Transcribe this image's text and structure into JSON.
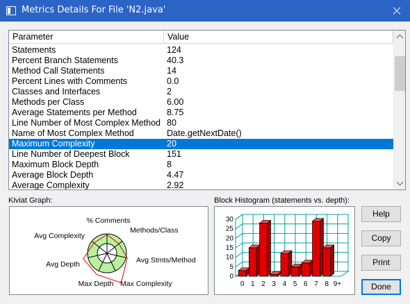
{
  "window": {
    "title": "Metrics Details For File 'N2.java'",
    "icon": "app-window-icon",
    "close_icon": "close-icon"
  },
  "table": {
    "columns": [
      "Parameter",
      "Value"
    ],
    "rows": [
      {
        "parameter": "Statements",
        "value": "124"
      },
      {
        "parameter": "Percent Branch Statements",
        "value": "40.3"
      },
      {
        "parameter": "Method Call Statements",
        "value": "14"
      },
      {
        "parameter": "Percent Lines with Comments",
        "value": "0.0"
      },
      {
        "parameter": "Classes and Interfaces",
        "value": "2"
      },
      {
        "parameter": "Methods per Class",
        "value": "6.00"
      },
      {
        "parameter": "Average Statements per Method",
        "value": "8.75"
      },
      {
        "parameter": "Line Number of Most Complex Method",
        "value": "80"
      },
      {
        "parameter": "Name of Most Complex Method",
        "value": "Date.getNextDate()"
      },
      {
        "parameter": "Maximum Complexity",
        "value": "20"
      },
      {
        "parameter": "Line Number of Deepest Block",
        "value": "151"
      },
      {
        "parameter": "Maximum Block Depth",
        "value": "8"
      },
      {
        "parameter": "Average Block Depth",
        "value": "4.47"
      },
      {
        "parameter": "Average Complexity",
        "value": "2.92"
      }
    ],
    "selected_index": 9,
    "selection_color": "#0078d7"
  },
  "kiviat": {
    "section_label": "Kiviat Graph:",
    "axes": [
      "% Comments",
      "Methods/Class",
      "Avg Stmts/Method",
      "Max Complexity",
      "Max Depth",
      "Avg Depth",
      "Avg Complexity"
    ],
    "ring_color": "#b8f0a0",
    "polygon_color": "#e00000"
  },
  "histogram": {
    "section_label": "Block Histogram (statements vs. depth):",
    "bar_color": "#e00000",
    "grid_color": "#00a0a0"
  },
  "chart_data": {
    "type": "bar",
    "title": "Block Histogram (statements vs. depth):",
    "categories": [
      "0",
      "1",
      "2",
      "3",
      "4",
      "5",
      "6",
      "7",
      "8",
      "9+"
    ],
    "values": [
      3,
      15,
      28,
      1,
      12,
      5,
      7,
      29,
      15,
      0
    ],
    "ylim": [
      0,
      30
    ],
    "yticks": [
      "0",
      "5",
      "10",
      "15",
      "20",
      "25",
      "30"
    ],
    "grid": true
  },
  "buttons": {
    "help": "Help",
    "copy": "Copy",
    "print": "Print",
    "done": "Done"
  }
}
